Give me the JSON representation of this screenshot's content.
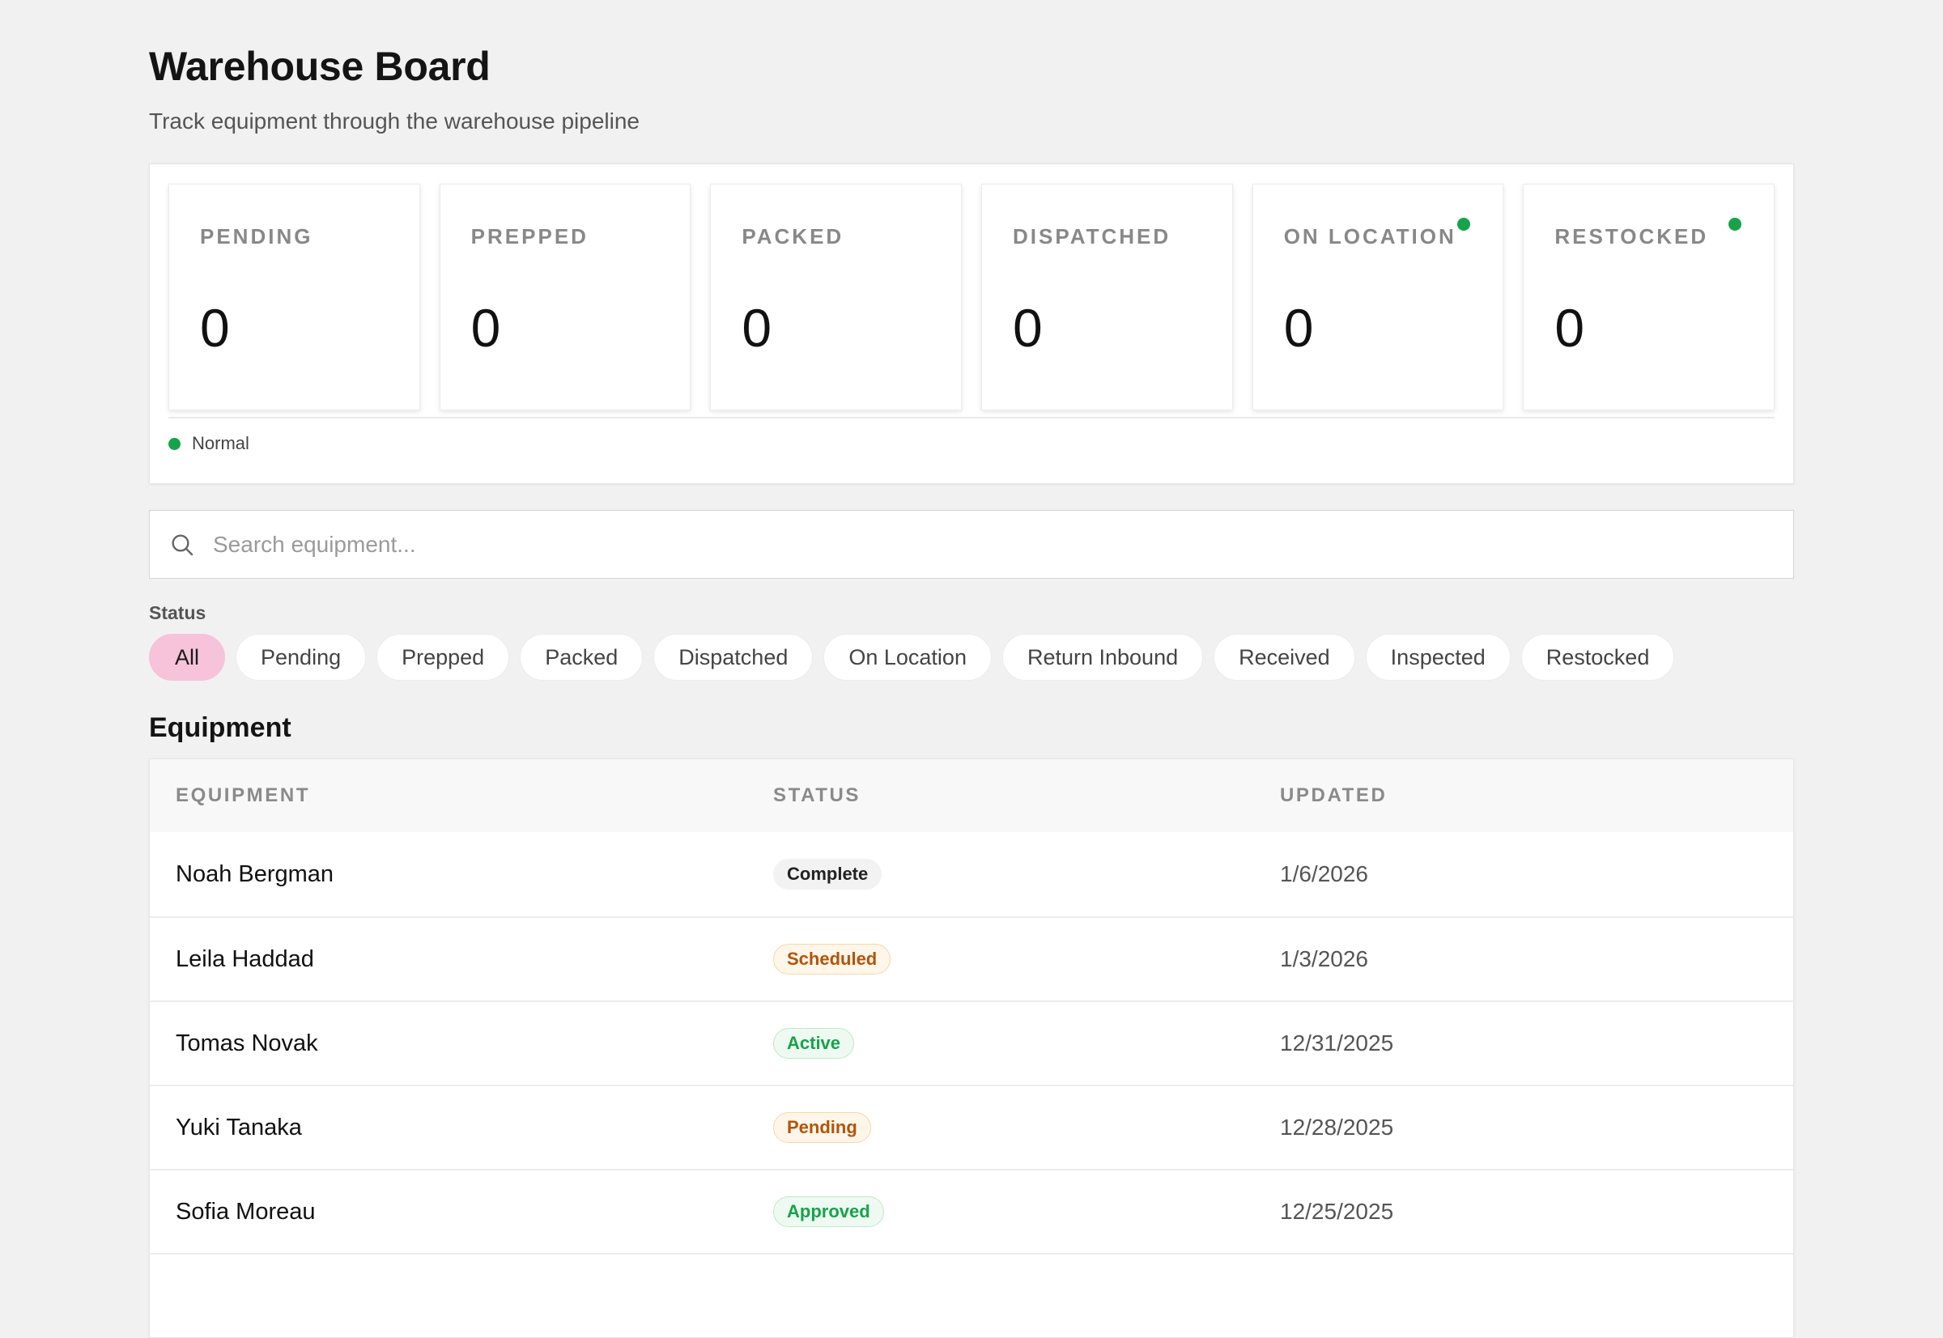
{
  "header": {
    "title": "Warehouse Board",
    "subtitle": "Track equipment through the warehouse pipeline"
  },
  "pipeline": {
    "stages": [
      {
        "label": "PENDING",
        "count": "0",
        "indicator": false
      },
      {
        "label": "PREPPED",
        "count": "0",
        "indicator": false
      },
      {
        "label": "PACKED",
        "count": "0",
        "indicator": false
      },
      {
        "label": "DISPATCHED",
        "count": "0",
        "indicator": false
      },
      {
        "label": "ON LOCATION",
        "count": "0",
        "indicator": true
      },
      {
        "label": "RESTOCKED",
        "count": "0",
        "indicator": true
      }
    ],
    "legend": {
      "label": "Normal",
      "color": "#17a34a"
    }
  },
  "search": {
    "placeholder": "Search equipment...",
    "value": ""
  },
  "filters": {
    "label": "Status",
    "options": [
      "All",
      "Pending",
      "Prepped",
      "Packed",
      "Dispatched",
      "On Location",
      "Return Inbound",
      "Received",
      "Inspected",
      "Restocked"
    ],
    "selected": "All",
    "accent": "#f6c3db"
  },
  "equipment": {
    "title": "Equipment",
    "columns": [
      "EQUIPMENT",
      "STATUS",
      "UPDATED"
    ],
    "rows": [
      {
        "name": "Noah Bergman",
        "status": "Complete",
        "tone": "neutral",
        "updated": "1/6/2026"
      },
      {
        "name": "Leila Haddad",
        "status": "Scheduled",
        "tone": "warning",
        "updated": "1/3/2026"
      },
      {
        "name": "Tomas Novak",
        "status": "Active",
        "tone": "success",
        "updated": "12/31/2025"
      },
      {
        "name": "Yuki Tanaka",
        "status": "Pending",
        "tone": "warning",
        "updated": "12/28/2025"
      },
      {
        "name": "Sofia Moreau",
        "status": "Approved",
        "tone": "success",
        "updated": "12/25/2025"
      },
      {
        "name": "",
        "status": "",
        "tone": "neutral",
        "updated": ""
      }
    ]
  }
}
